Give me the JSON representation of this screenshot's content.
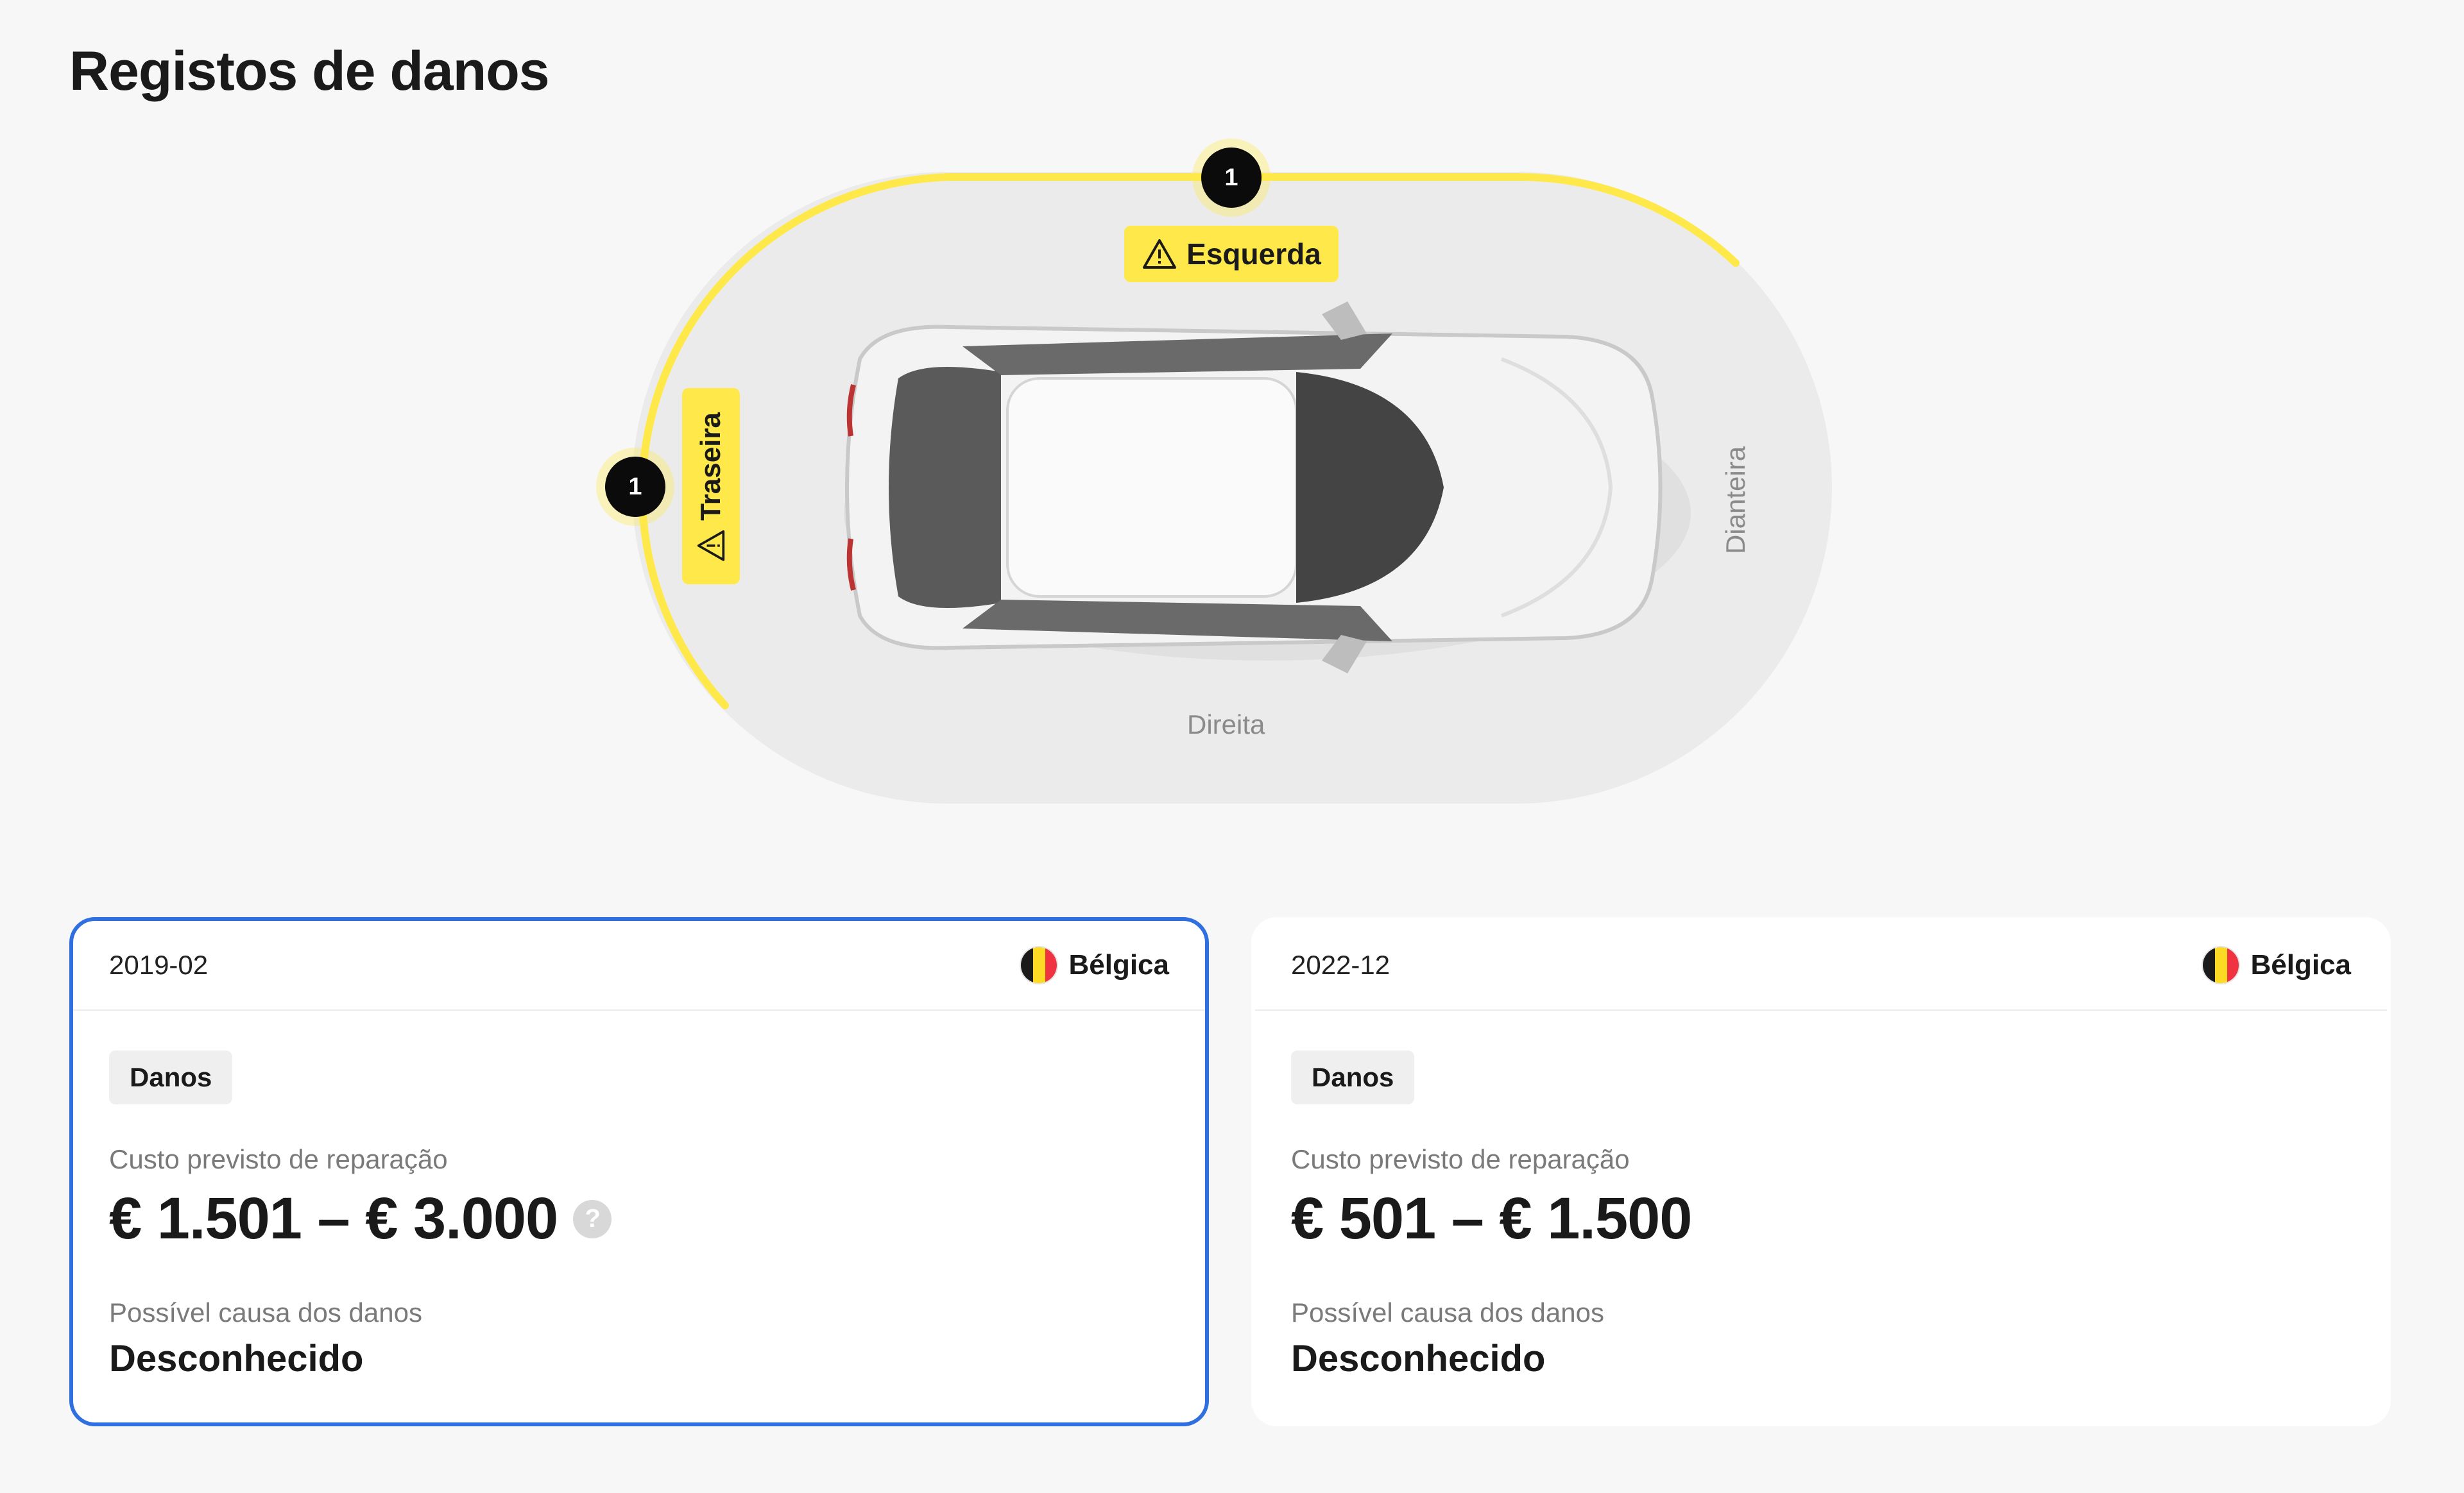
{
  "page": {
    "title": "Registos de danos"
  },
  "diagram": {
    "markers": {
      "left_count": "1",
      "rear_count": "1"
    },
    "tags": {
      "left": "Esquerda",
      "rear": "Traseira"
    },
    "sides": {
      "right": "Direita",
      "front": "Dianteira"
    },
    "highlight_color": "#ffe94a"
  },
  "records": [
    {
      "date": "2019-02",
      "country": "Bélgica",
      "badge": "Danos",
      "cost_label": "Custo previsto de reparação",
      "cost": "€ 1.501 – € 3.000",
      "help_icon": "?",
      "cause_label": "Possível causa dos danos",
      "cause": "Desconhecido",
      "selected": true
    },
    {
      "date": "2022-12",
      "country": "Bélgica",
      "badge": "Danos",
      "cost_label": "Custo previsto de reparação",
      "cost": "€ 501 – € 1.500",
      "cause_label": "Possível causa dos danos",
      "cause": "Desconhecido",
      "selected": false
    }
  ]
}
